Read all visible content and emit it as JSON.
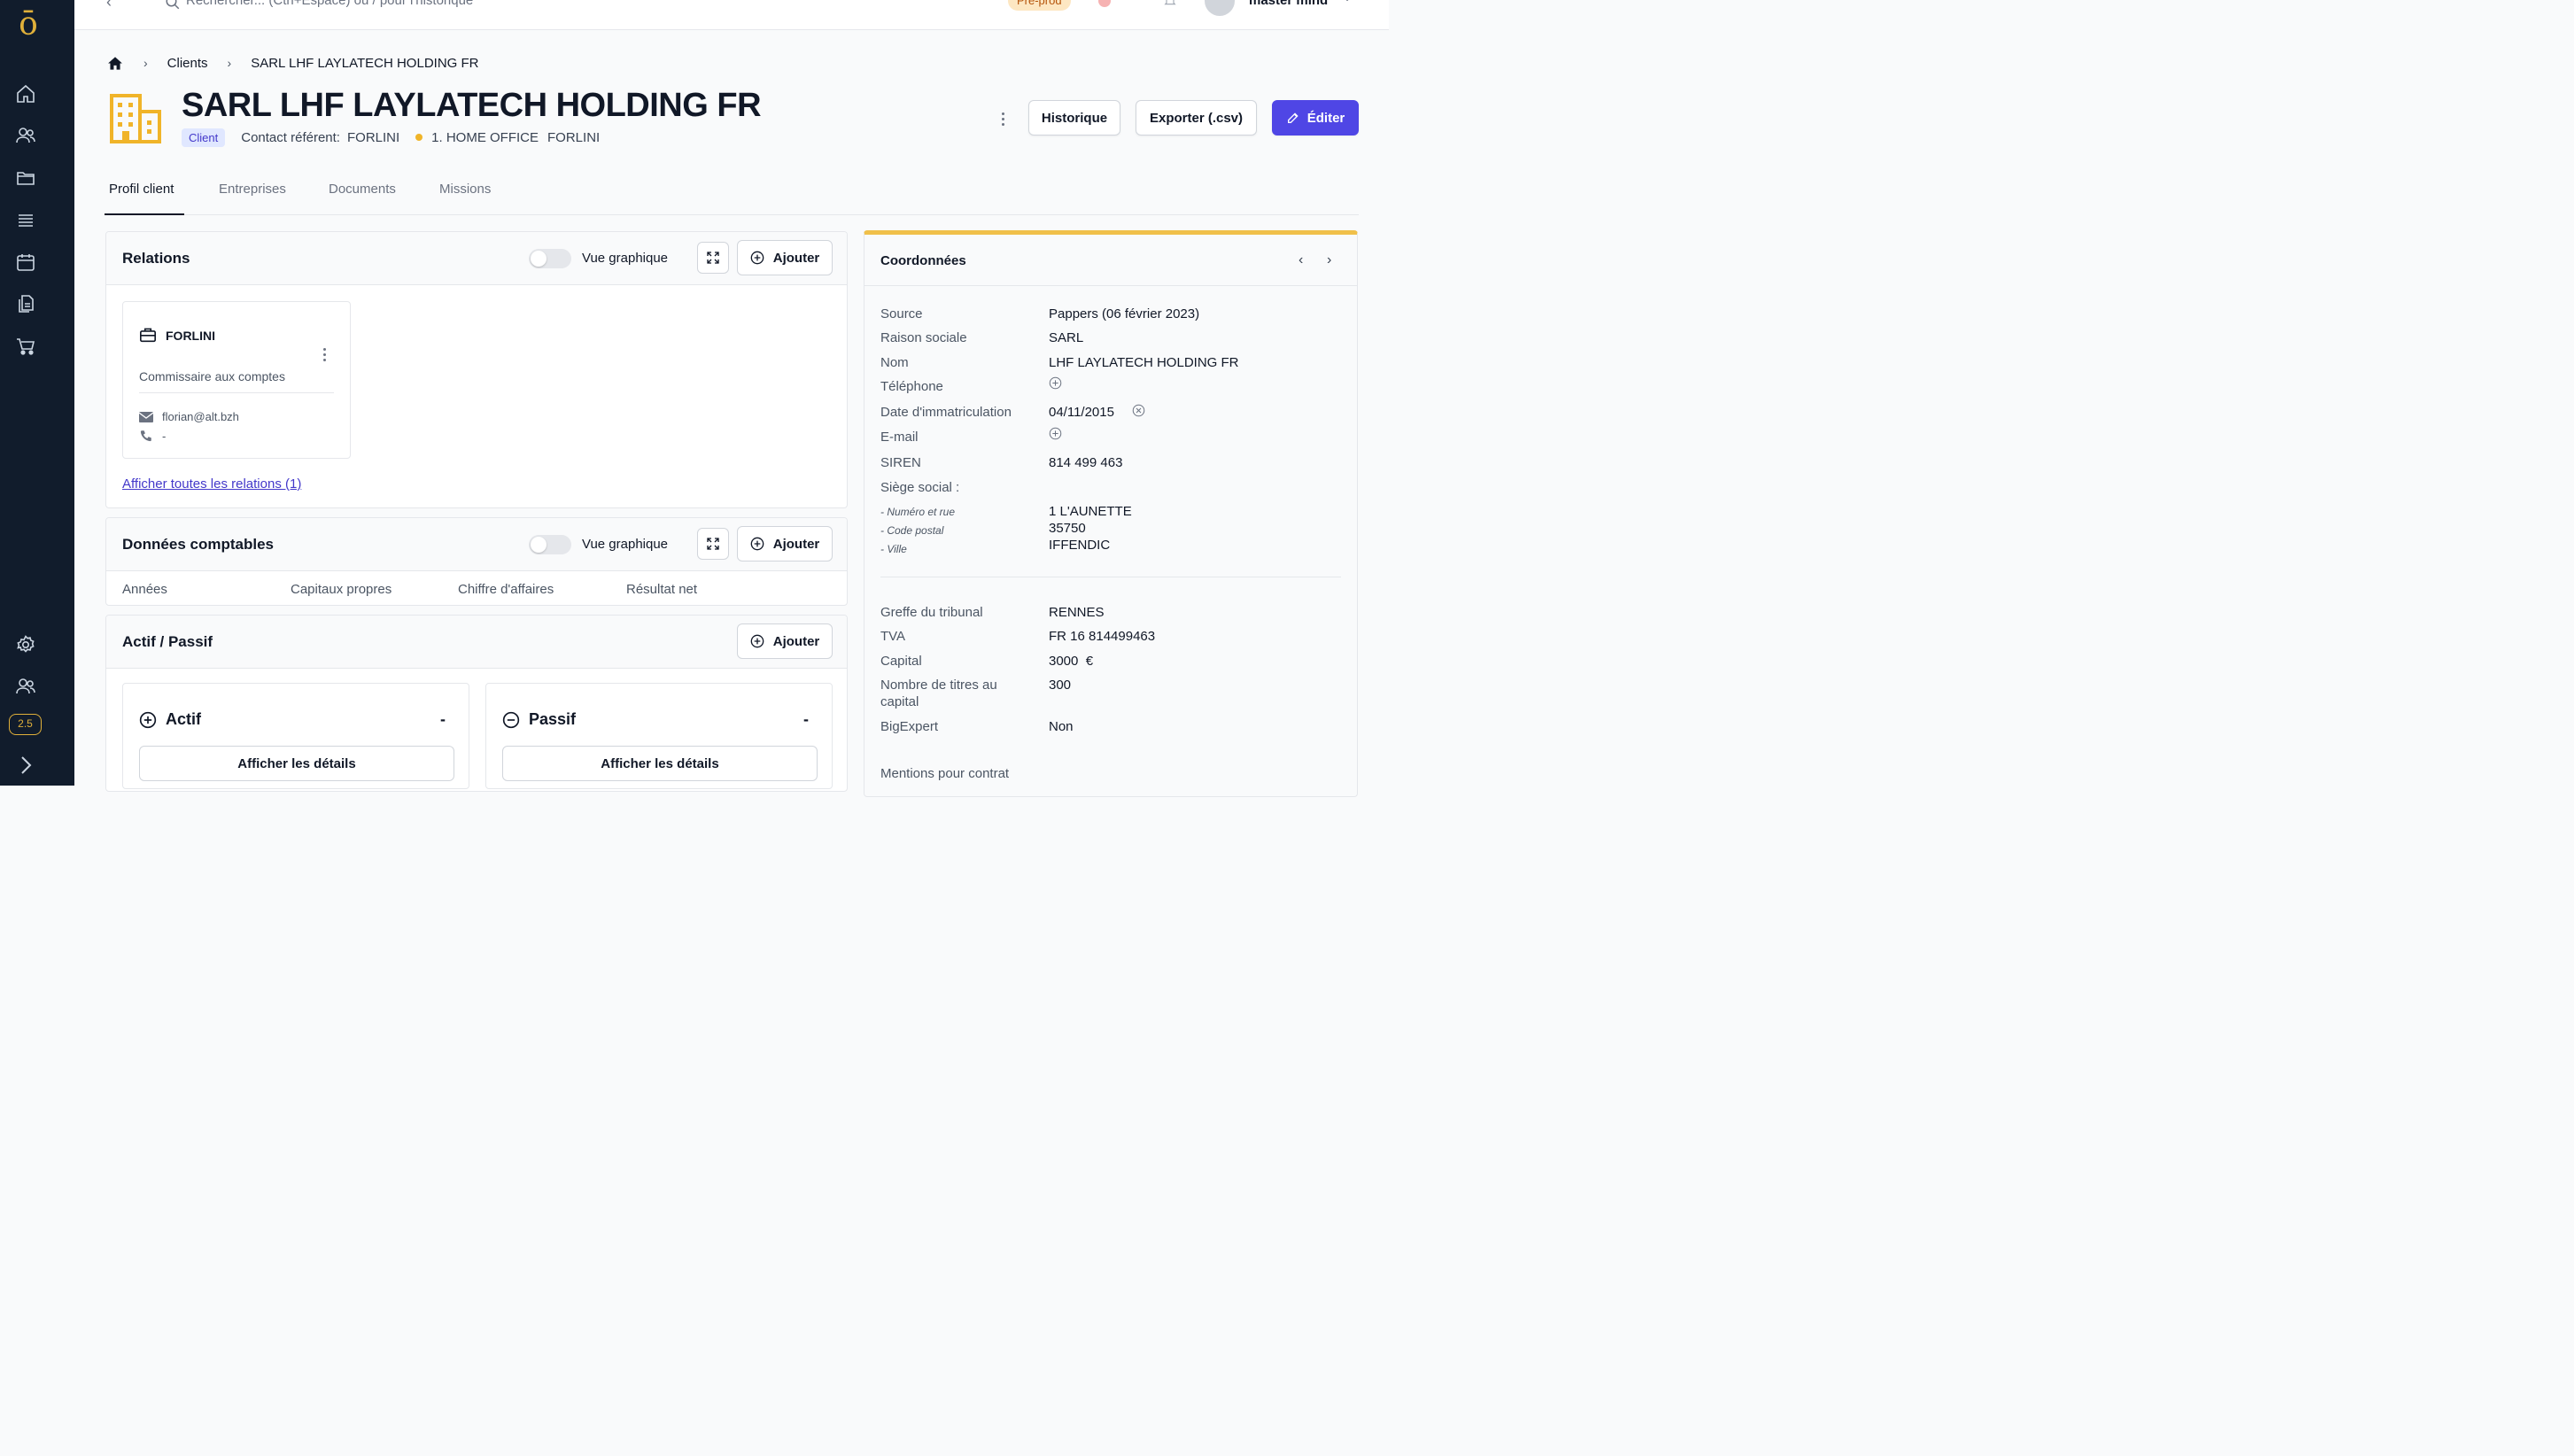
{
  "sidebar": {
    "logo": "ō",
    "items": [
      "home-icon",
      "users-icon",
      "folder-icon",
      "list-icon",
      "calendar-icon",
      "documents-icon",
      "cart-icon"
    ],
    "bottom": [
      "settings-icon",
      "team-icon"
    ],
    "version": "2.5"
  },
  "topbar": {
    "search_placeholder": "Rechercher... (Ctrl+Espace) ou / pour l'historique",
    "env_badge": "Pré-prod",
    "user_name": "master mind"
  },
  "breadcrumb": {
    "level1": "Clients",
    "level2": "SARL LHF LAYLATECH HOLDING FR"
  },
  "header": {
    "title": "SARL LHF LAYLATECH HOLDING FR",
    "badge": "Client",
    "contact_label": "Contact référent:",
    "contact_value": "FORLINI",
    "status": "1. HOME OFFICE",
    "status_owner": "FORLINI",
    "history_label": "Historique",
    "export_label": "Exporter (.csv)",
    "edit_label": "Éditer"
  },
  "tabs": [
    "Profil client",
    "Entreprises",
    "Documents",
    "Missions"
  ],
  "relations": {
    "title": "Relations",
    "toggle_label": "Vue graphique",
    "add_label": "Ajouter",
    "card": {
      "name": "FORLINI",
      "role": "Commissaire aux comptes",
      "email": "florian@alt.bzh",
      "phone": "-"
    },
    "link": "Afficher toutes les relations (1)"
  },
  "donnees": {
    "title": "Données comptables",
    "toggle_label": "Vue graphique",
    "add_label": "Ajouter",
    "columns": [
      "Années",
      "Capitaux propres",
      "Chiffre d'affaires",
      "Résultat net"
    ]
  },
  "actif_passif": {
    "title": "Actif / Passif",
    "add_label": "Ajouter",
    "actif": {
      "title": "Actif",
      "value": "-",
      "button": "Afficher les détails"
    },
    "passif": {
      "title": "Passif",
      "value": "-",
      "button": "Afficher les détails"
    }
  },
  "coordonnees": {
    "title": "Coordonnées",
    "source_label": "Source",
    "source_value": "Pappers (06 février 2023)",
    "raison_label": "Raison sociale",
    "raison_value": "SARL",
    "nom_label": "Nom",
    "nom_value": "LHF LAYLATECH HOLDING FR",
    "tel_label": "Téléphone",
    "immat_label": "Date d'immatriculation",
    "immat_value": "04/11/2015",
    "email_label": "E-mail",
    "siren_label": "SIREN",
    "siren_value": "814 499 463",
    "siege_label": "Siège social :",
    "rue_label": "- Numéro et rue",
    "rue_value": "1 L'AUNETTE",
    "cp_label": "- Code postal",
    "cp_value": "35750",
    "ville_label": "- Ville",
    "ville_value": "IFFENDIC",
    "greffe_label": "Greffe du tribunal",
    "greffe_value": "RENNES",
    "tva_label": "TVA",
    "tva_value": "FR 16 814499463",
    "capital_label": "Capital",
    "capital_value": "3000  €",
    "titres_label": "Nombre de titres au capital",
    "titres_value": "300",
    "bigexpert_label": "BigExpert",
    "bigexpert_value": "Non",
    "mentions_label": "Mentions pour contrat"
  },
  "colors": {
    "accent": "#4f46e5",
    "gold": "#f0b429",
    "sidebar": "#111c2c"
  }
}
